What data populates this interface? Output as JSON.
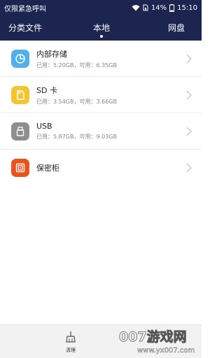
{
  "status_bar": {
    "carrier": "仅限紧急呼叫",
    "battery": "14%",
    "time": "15:10"
  },
  "tabs": {
    "left": "分类文件",
    "center": "本地",
    "right": "网盘"
  },
  "storage_items": [
    {
      "title": "内部存储",
      "sub": "已用：5.20GB，可用：6.35GB",
      "icon": "pie-chart-icon",
      "color": "#4fb0ec"
    },
    {
      "title": "SD 卡",
      "sub": "已用：3.54GB，可用：3.66GB",
      "icon": "sd-card-icon",
      "color": "#f4c431"
    },
    {
      "title": "USB",
      "sub": "已用：5.87GB，可用：9.03GB",
      "icon": "usb-icon",
      "color": "#8e8e8e"
    },
    {
      "title": "保密柜",
      "sub": "",
      "icon": "safe-icon",
      "color": "#e8541b"
    }
  ],
  "footer": {
    "clean_label": "清理"
  },
  "watermark": {
    "text_main": "007游戏网",
    "text_url": "www.yx007.com"
  }
}
